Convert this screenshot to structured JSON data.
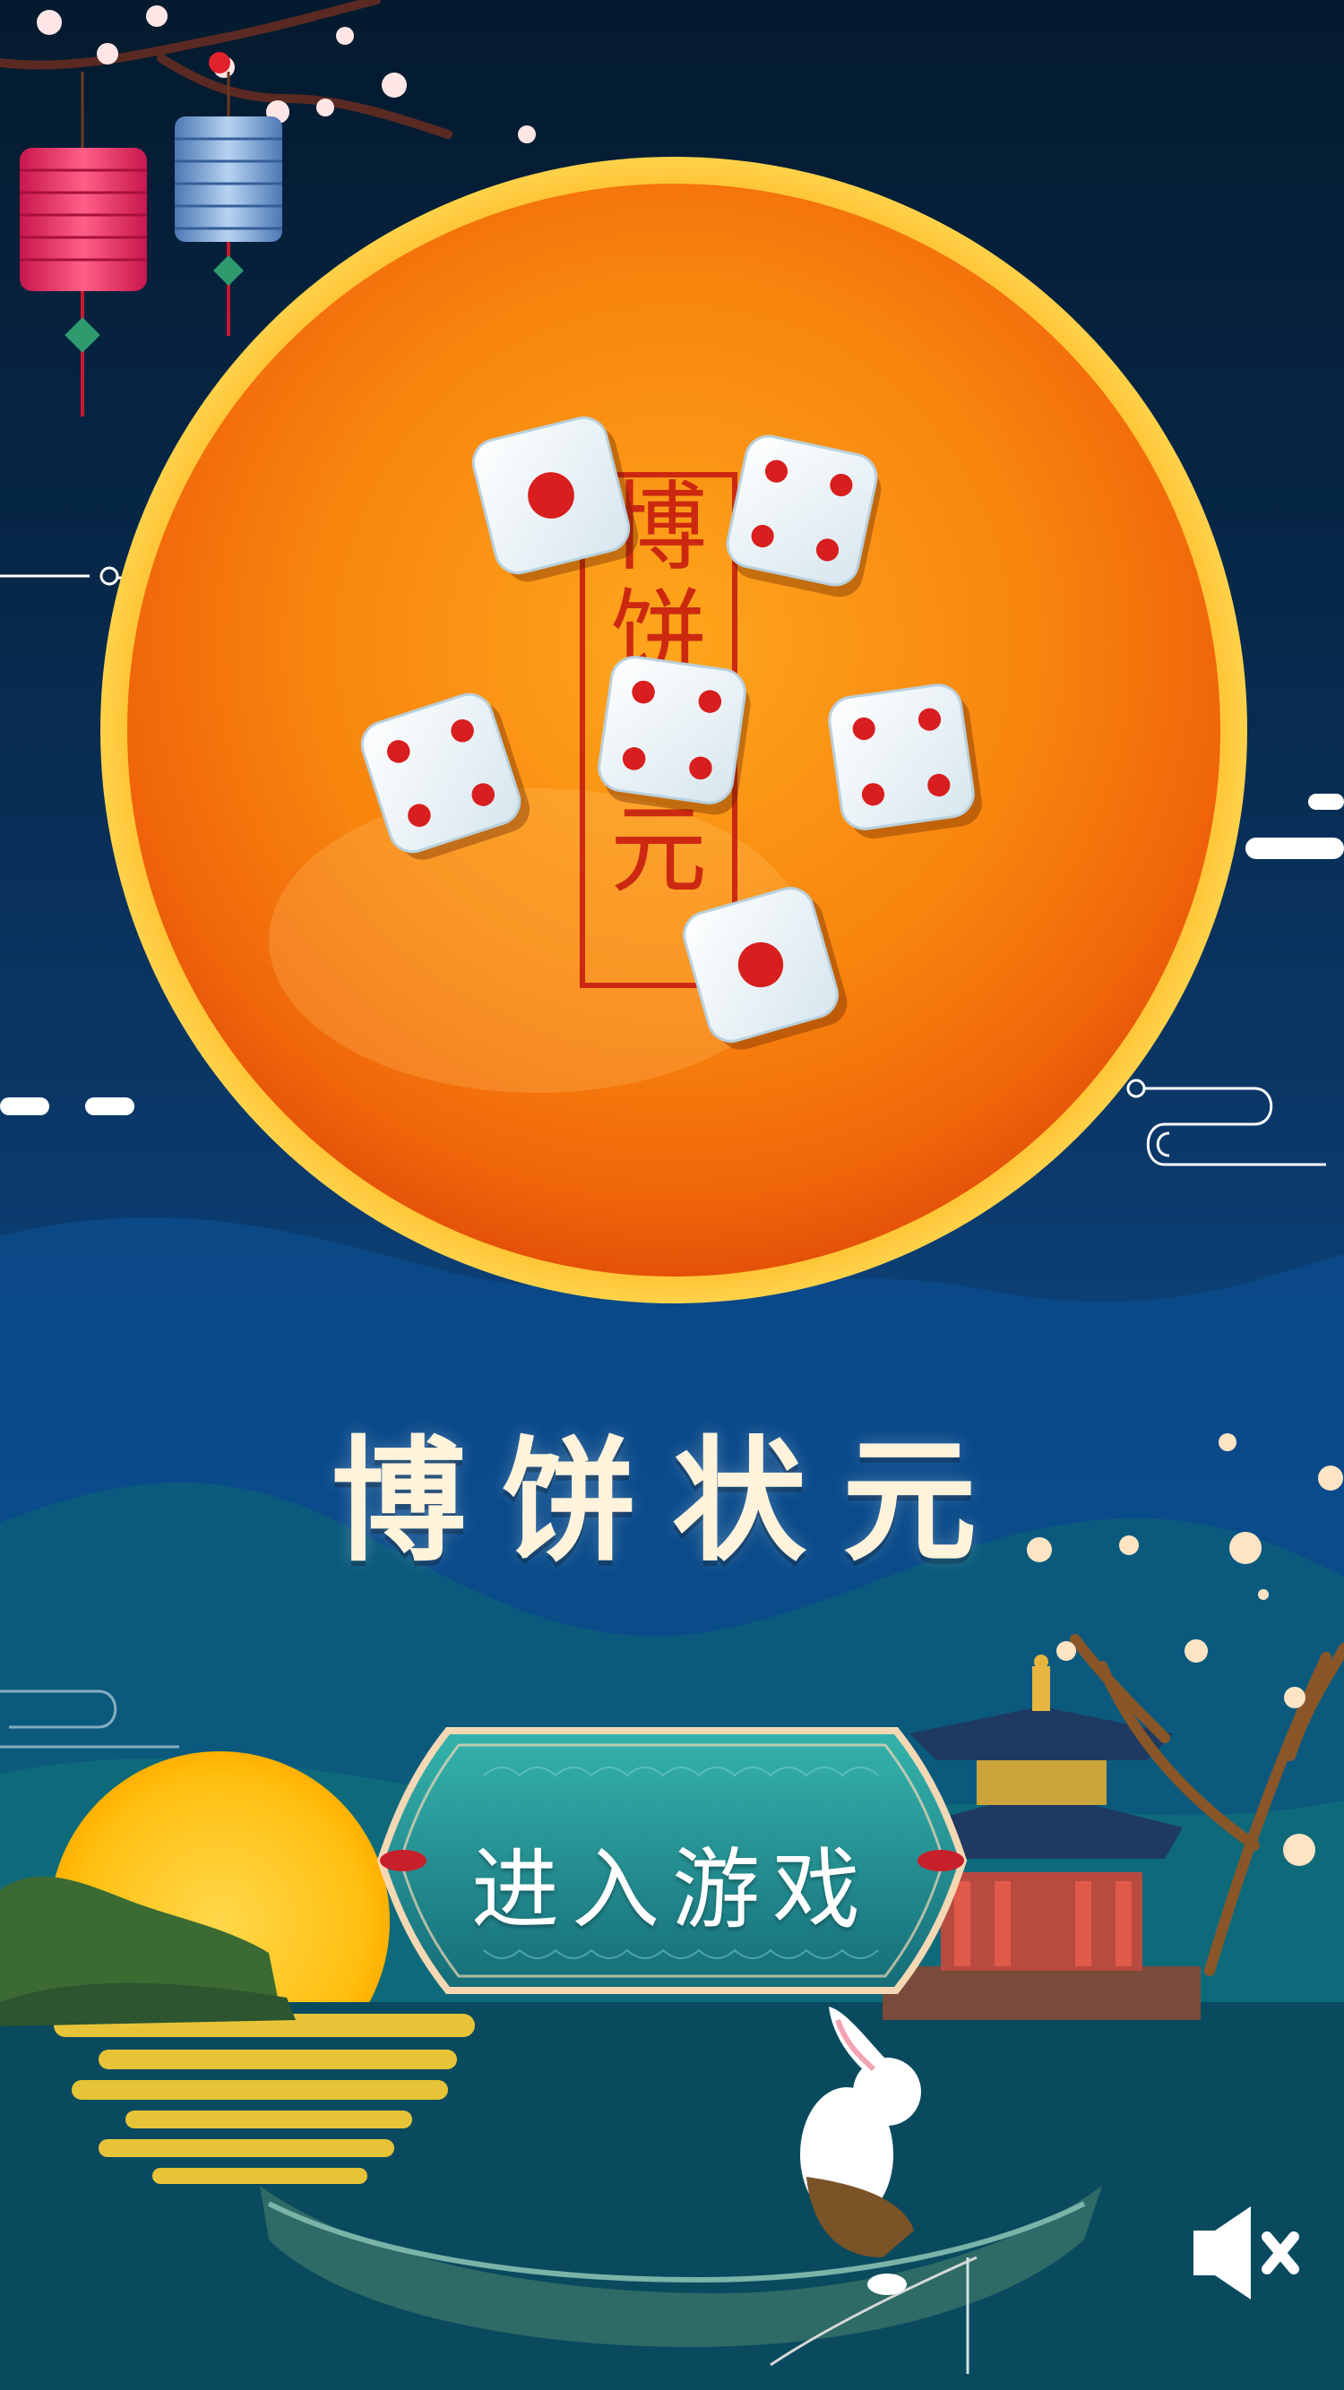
{
  "game": {
    "title": "博饼状元",
    "plate_label": "博饼状元",
    "enter_button_label": "进入游戏",
    "sound": "muted"
  },
  "icons": {
    "mute": "speaker-mute-icon",
    "dice": "dice-icon",
    "lantern": "lantern-icon"
  },
  "dice_faces": [
    1,
    4,
    4,
    4,
    4,
    1
  ],
  "colors": {
    "night_sky": "#041a2e",
    "plate_orange": "#f49a0e",
    "dice_pip_red": "#d81e1e",
    "title_cream": "#fff3dc",
    "button_teal": "#1f8c8e",
    "moon_yellow": "#ffc11a"
  }
}
